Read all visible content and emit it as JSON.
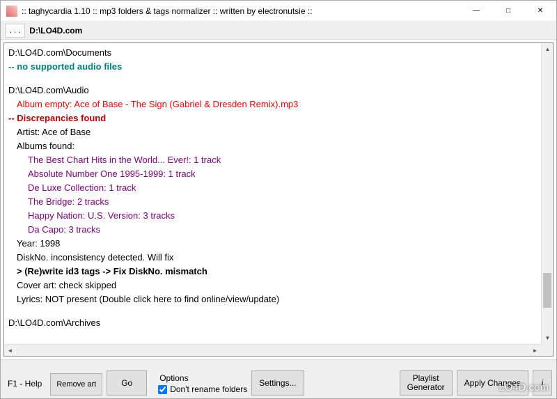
{
  "titlebar": {
    "title": ":: taghycardia 1.10 :: mp3 folders & tags normalizer :: written by electronutsie ::"
  },
  "pathbar": {
    "browse_btn": ". . .",
    "path": "D:\\LO4D.com"
  },
  "log": {
    "l01": "D:\\LO4D.com\\Documents",
    "l02": " -- no supported audio files",
    "l03": "D:\\LO4D.com\\Audio",
    "l04": "Album empty: Ace of Base - The Sign (Gabriel & Dresden Remix).mp3",
    "l05": " -- Discrepancies found",
    "l06": "Artist: Ace of Base",
    "l07": "Albums found:",
    "l08": "The Best Chart Hits in the World... Ever!: 1 track",
    "l09": "Absolute Number One 1995-1999: 1 track",
    "l10": "De Luxe Collection: 1 track",
    "l11": "The Bridge: 2 tracks",
    "l12": "Happy Nation: U.S. Version: 3 tracks",
    "l13": "Da Capo: 3 tracks",
    "l14": "Year: 1998",
    "l15": "DiskNo. inconsistency detected. Will fix",
    "l16": "> (Re)write id3 tags -> Fix DiskNo. mismatch",
    "l17": "Cover art: check skipped",
    "l18": "Lyrics: NOT present (Double click here to find online/view/update)",
    "l19": "D:\\LO4D.com\\Archives"
  },
  "bottom": {
    "help": "F1 - Help",
    "remove_art": "Remove art",
    "go": "Go",
    "options_label": "Options",
    "dont_rename": "Don't rename folders",
    "settings": "Settings...",
    "playlist_gen": "Playlist\nGenerator",
    "apply": "Apply Changes",
    "info": "i"
  },
  "watermark": "LO4D.com"
}
